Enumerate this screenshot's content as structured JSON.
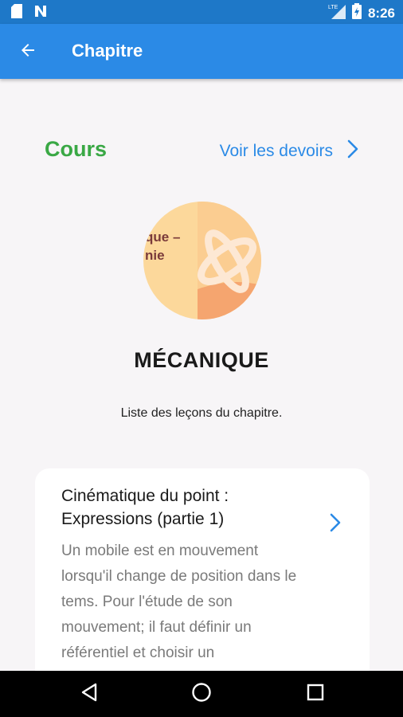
{
  "status_bar": {
    "time": "8:26",
    "icons": [
      "sd-card-icon",
      "notification-n-icon",
      "lte-signal-icon",
      "battery-icon"
    ]
  },
  "app_bar": {
    "title": "Chapitre",
    "back_icon": "arrow-back-icon"
  },
  "section": {
    "heading": "Cours",
    "link_label": "Voir les devoirs"
  },
  "chapter": {
    "image_text_line1": "que –",
    "image_text_line2": "nie",
    "title": "MÉCANIQUE",
    "description": "Liste des leçons du chapitre."
  },
  "lessons": [
    {
      "title": "Cinématique du point : Expressions (partie 1)",
      "summary": "Un mobile est en mouvement lorsqu'il change de position dans le tems. Pour l'étude de son mouvement; il faut définir un référentiel et choisir un"
    }
  ],
  "nav_bar": {
    "buttons": [
      "back-triangle-icon",
      "home-circle-icon",
      "recents-square-icon"
    ]
  },
  "colors": {
    "status_bar": "#1e78c8",
    "app_bar": "#2b8ae6",
    "accent_green": "#3aa845",
    "link_blue": "#2b8ae6",
    "background": "#f7f5f7"
  }
}
